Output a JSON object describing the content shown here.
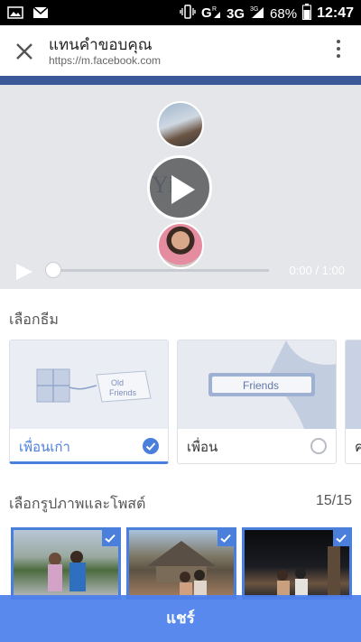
{
  "status_bar": {
    "network": "3G",
    "battery": "68%",
    "time": "12:47"
  },
  "header": {
    "title": "แทนคำขอบคุณ",
    "url": "https://m.facebook.com"
  },
  "video": {
    "overlay_text": "Yi",
    "time": "0:00 / 1:00",
    "progress": 0
  },
  "themes": {
    "title": "เลือกธีม",
    "items": [
      {
        "label": "เพื่อนเก่า",
        "art_text": "Old Friends",
        "selected": true
      },
      {
        "label": "เพื่อน",
        "art_text": "Friends",
        "selected": false
      },
      {
        "label": "ค",
        "art_text": "",
        "selected": false
      }
    ]
  },
  "photos": {
    "title": "เลือกรูปภาพและโพสต์",
    "count": "15/15"
  },
  "share": {
    "label": "แชร์"
  },
  "colors": {
    "accent": "#4a7fdb",
    "facebook": "#3b5998"
  }
}
